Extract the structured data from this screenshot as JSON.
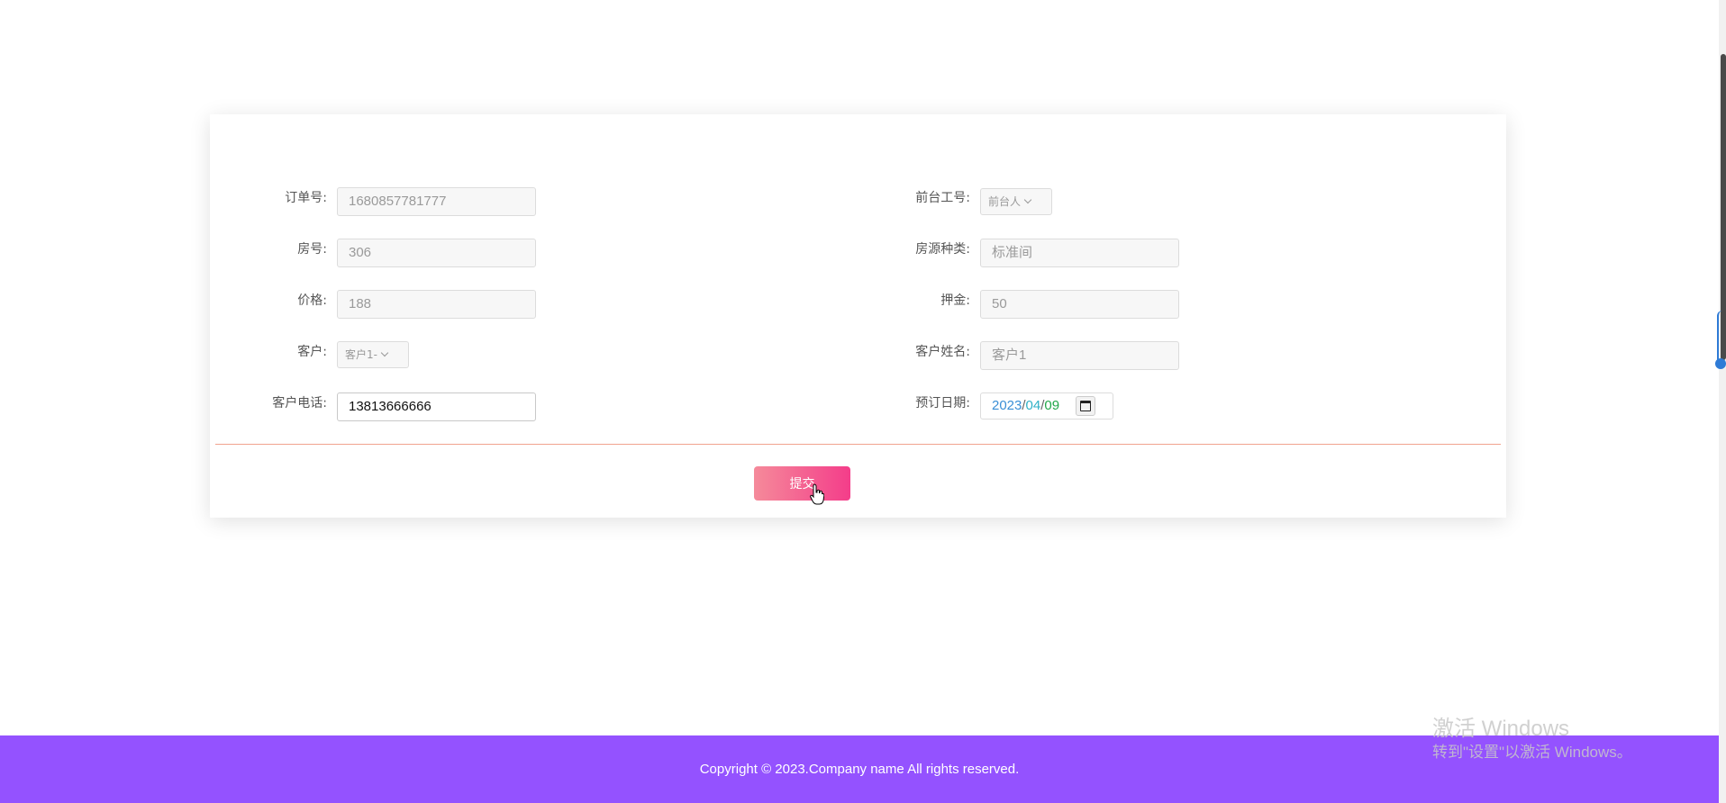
{
  "form": {
    "order_no": {
      "label": "订单号:",
      "value": "1680857781777"
    },
    "staff_no": {
      "label": "前台工号:",
      "selected": "前台人"
    },
    "room_no": {
      "label": "房号:",
      "value": "306"
    },
    "room_type": {
      "label": "房源种类:",
      "value": "标准间"
    },
    "price": {
      "label": "价格:",
      "value": "188"
    },
    "deposit": {
      "label": "押金:",
      "value": "50"
    },
    "customer": {
      "label": "客户:",
      "selected": "客户1-"
    },
    "customer_name": {
      "label": "客户姓名:",
      "value": "客户1"
    },
    "customer_phone": {
      "label": "客户电话:",
      "value": "13813666666"
    },
    "booking_date": {
      "label": "预订日期:",
      "year": "2023",
      "month": "04",
      "day": "09",
      "sep": "/"
    },
    "submit_label": "提交"
  },
  "footer": {
    "copyright": "Copyright © 2023.Company name All rights reserved."
  },
  "watermark": {
    "title": "激活 Windows",
    "subtitle": "转到\"设置\"以激活 Windows。"
  },
  "colors": {
    "footer_bg": "#9452ff",
    "button_gradient_start": "#f58a9a",
    "button_gradient_end": "#f43d8a",
    "divider": "#f1a48f"
  }
}
